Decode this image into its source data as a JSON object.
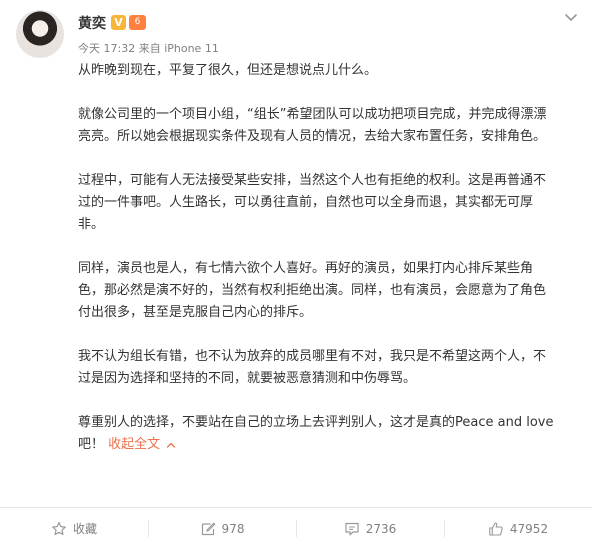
{
  "user": {
    "name": "黄奕",
    "vip_glyph": "V",
    "level_glyph": "6"
  },
  "meta": {
    "time": "今天 17:32",
    "source": "来自 iPhone 11"
  },
  "paragraphs": [
    "从昨晚到现在，平复了很久，但还是想说点儿什么。",
    "就像公司里的一个项目小组，“组长”希望团队可以成功把项目完成，并完成得漂漂亮亮。所以她会根据现实条件及现有人员的情况，去给大家布置任务，安排角色。",
    "过程中，可能有人无法接受某些安排，当然这个人也有拒绝的权利。这是再普通不过的一件事吧。人生路长，可以勇往直前，自然也可以全身而退，其实都无可厚非。",
    "同样，演员也是人，有七情六欲个人喜好。再好的演员，如果打内心排斥某些角色，那必然是演不好的，当然有权利拒绝出演。同样，也有演员，会愿意为了角色付出很多，甚至是克服自己内心的排斥。",
    "我不认为组长有错，也不认为放弃的成员哪里有不对，我只是不希望这两个人，不过是因为选择和坚持的不同，就要被恶意猜测和中伤辱骂。",
    "尊重别人的选择，不要站在自己的立场上去评判别人，这才是真的Peace and love吧！"
  ],
  "collapse_label": "收起全文",
  "actions": {
    "favorite": "收藏",
    "repost": "978",
    "comment": "2736",
    "like": "47952"
  },
  "icons": {
    "more": "chevron-down-icon",
    "favorite": "star-icon",
    "repost": "repost-icon",
    "comment": "comment-icon",
    "like": "thumbs-up-icon"
  },
  "colors": {
    "link": "#eb7350",
    "meta": "#808080",
    "vip": "#f7b63a",
    "level": "#ff8140"
  }
}
